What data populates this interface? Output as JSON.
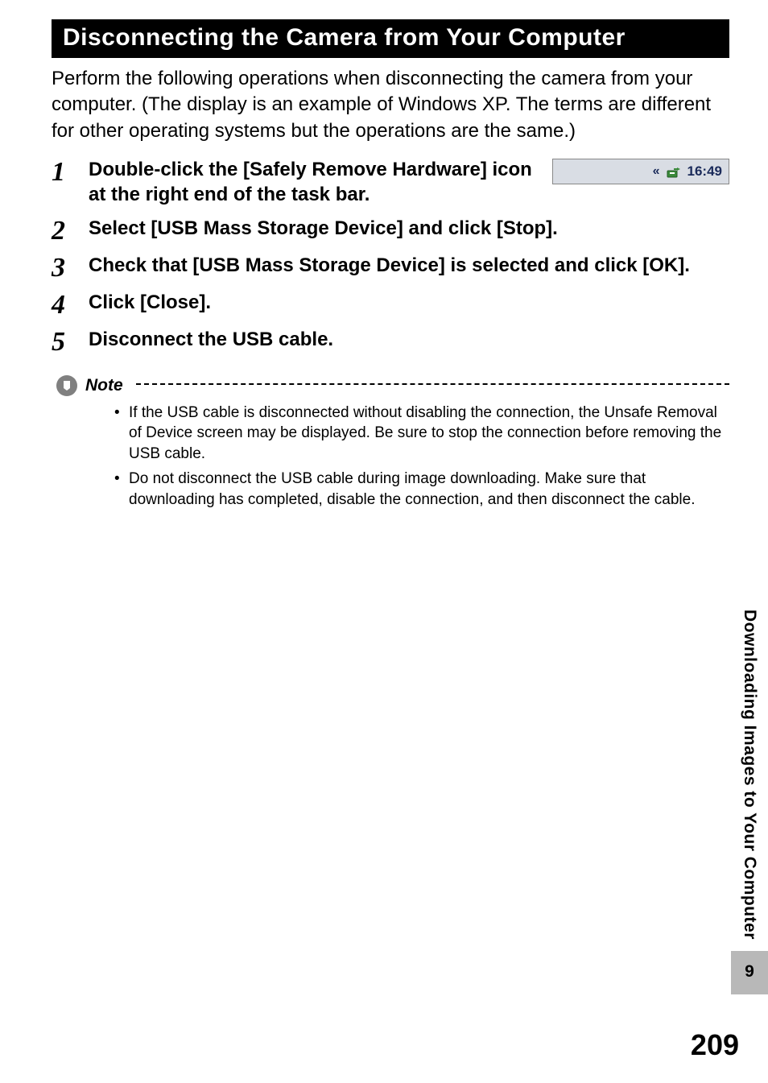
{
  "banner": "Disconnecting the Camera from Your Computer",
  "intro": "Perform the following operations when disconnecting the camera from your computer. (The display is an example of Windows XP. The terms are different for other operating systems but the operations are the same.)",
  "steps": [
    {
      "num": "1",
      "text": "Double-click the [Safely Remove Hardware] icon at the right end of the task bar."
    },
    {
      "num": "2",
      "text": "Select [USB Mass Storage Device] and click [Stop]."
    },
    {
      "num": "3",
      "text": "Check that [USB Mass Storage Device] is selected and click [OK]."
    },
    {
      "num": "4",
      "text": "Click [Close]."
    },
    {
      "num": "5",
      "text": "Disconnect the USB cable."
    }
  ],
  "taskbar": {
    "chevron": "«",
    "icon_name": "safely-remove-hardware-icon",
    "clock": "16:49"
  },
  "note": {
    "label": "Note",
    "items": [
      "If the USB cable is disconnected without disabling the connection, the Unsafe Removal of Device screen may be displayed. Be sure to stop the connection before removing the USB cable.",
      "Do not disconnect the USB cable during image downloading. Make sure that downloading has completed, disable the connection, and then disconnect the cable."
    ]
  },
  "side_tab": {
    "text": "Downloading Images to Your Computer",
    "chapter": "9"
  },
  "page_number": "209"
}
